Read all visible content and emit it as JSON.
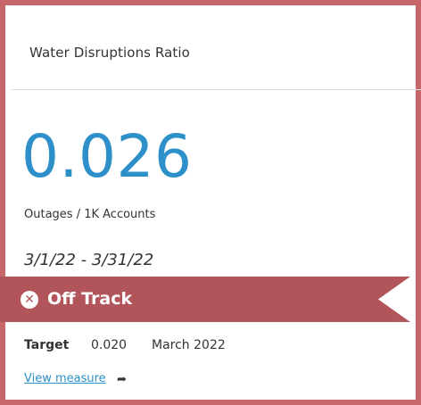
{
  "card": {
    "title": "Water Disruptions Ratio",
    "value": "0.026",
    "unit": "Outages / 1K Accounts",
    "date_range": "3/1/22 - 3/31/22",
    "status": {
      "label": "Off Track",
      "icon": "x-circle-icon"
    },
    "target": {
      "label": "Target",
      "value": "0.020",
      "period": "March 2022"
    },
    "link": {
      "label": "View measure",
      "icon": "arrow-icon"
    }
  },
  "colors": {
    "border": "#c8676b",
    "ribbon": "#b2555a",
    "value": "#2e90c9",
    "link": "#2e90c9"
  }
}
